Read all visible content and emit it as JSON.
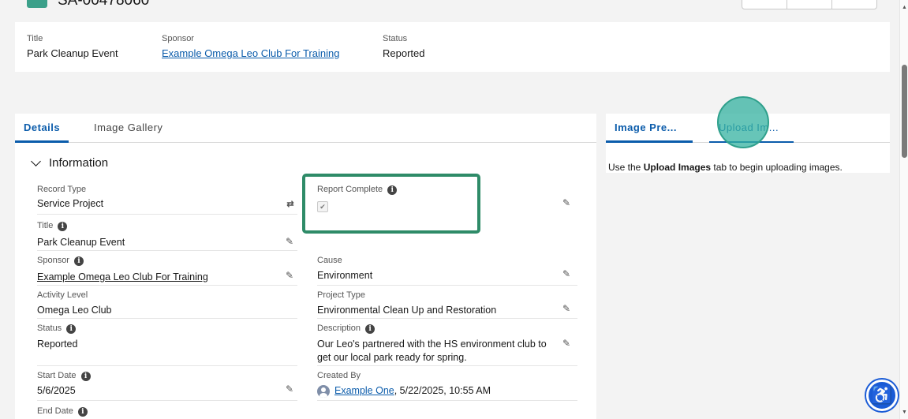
{
  "header": {
    "record_name": "SA-00478060"
  },
  "highlights": {
    "title_label": "Title",
    "title_value": "Park Cleanup Event",
    "sponsor_label": "Sponsor",
    "sponsor_value": "Example Omega Leo Club For Training",
    "status_label": "Status",
    "status_value": "Reported"
  },
  "left_tabs": {
    "details": "Details",
    "image_gallery": "Image Gallery"
  },
  "section": {
    "title": "Information"
  },
  "fields": {
    "record_type_label": "Record Type",
    "record_type_value": "Service Project",
    "title_label": "Title",
    "title_value": "Park Cleanup Event",
    "sponsor_label": "Sponsor",
    "sponsor_value": "Example Omega Leo Club For Training",
    "activity_level_label": "Activity Level",
    "activity_level_value": "Omega Leo Club",
    "status_label": "Status",
    "status_value": "Reported",
    "start_date_label": "Start Date",
    "start_date_value": "5/6/2025",
    "end_date_label": "End Date",
    "report_complete_label": "Report Complete",
    "report_complete_checked": true,
    "cause_label": "Cause",
    "cause_value": "Environment",
    "project_type_label": "Project Type",
    "project_type_value": "Environmental Clean Up and Restoration",
    "description_label": "Description",
    "description_value": "Our Leo's partnered with the HS environment club to get our local park ready for spring.",
    "created_by_label": "Created By",
    "created_by_user": "Example One",
    "created_by_date": ", 5/22/2025, 10:55 AM"
  },
  "right_tabs": {
    "image_preview": "Image Pre...",
    "upload_images": "Upload Im..."
  },
  "right_panel": {
    "msg_prefix": "Use the ",
    "msg_bold": "Upload Images",
    "msg_suffix": " tab to begin uploading images."
  },
  "icons": {
    "info": "info-icon",
    "edit": "pencil-icon",
    "change_record_type": "swap-icon",
    "accessibility": "accessibility-icon"
  },
  "colors": {
    "link": "#0b5cab",
    "highlight_box": "#2e8b68",
    "cursor": "#34b2a0",
    "a11y": "#1a5bd6"
  }
}
